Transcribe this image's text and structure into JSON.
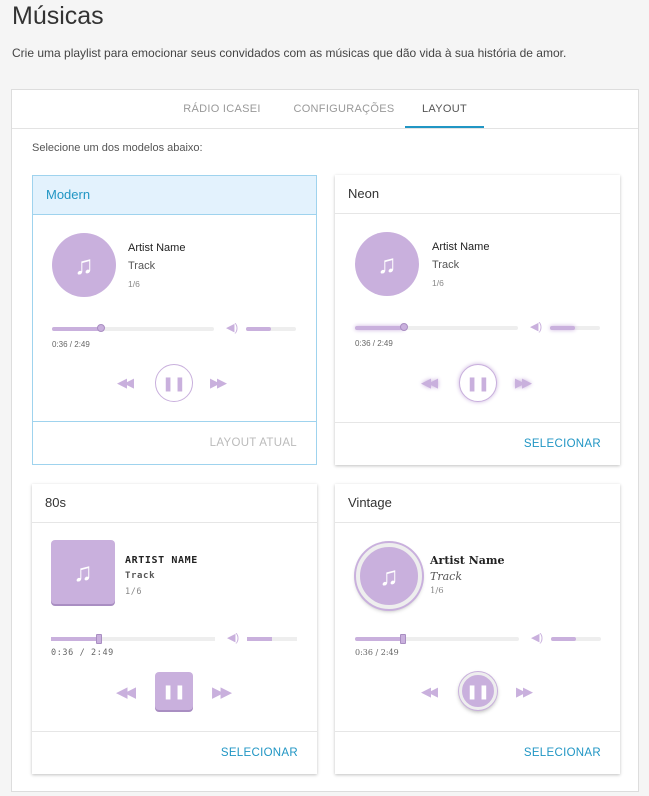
{
  "page": {
    "title": "Músicas",
    "subtitle": "Crie uma playlist para emocionar seus convidados com as músicas que dão vida à sua história de amor."
  },
  "tabs": [
    {
      "label": "RÁDIO ICASEI",
      "active": false
    },
    {
      "label": "CONFIGURAÇÕES",
      "active": false
    },
    {
      "label": "LAYOUT",
      "active": true
    }
  ],
  "instructions": "Selecione um dos modelos abaixo:",
  "accent_color": "#2196c4",
  "player_color": "#c9b0dd",
  "icons": {
    "cover": "music-note-icon",
    "rewind": "rewind-icon",
    "pause": "pause-icon",
    "forward": "fast-forward-icon",
    "volume": "volume-icon"
  },
  "layouts": [
    {
      "name": "Modern",
      "artist": "Artist Name",
      "track": "Track",
      "count": "1/6",
      "time": "0:36 / 2:49",
      "progress": 0.3,
      "volume": 0.5,
      "action": "LAYOUT ATUAL",
      "selected": true
    },
    {
      "name": "Neon",
      "artist": "Artist Name",
      "track": "Track",
      "count": "1/6",
      "time": "0:36 / 2:49",
      "progress": 0.3,
      "volume": 0.5,
      "action": "SELECIONAR",
      "selected": false
    },
    {
      "name": "80s",
      "artist": "ARTIST NAME",
      "track": "Track",
      "count": "1/6",
      "time": "0:36 / 2:49",
      "progress": 0.3,
      "volume": 0.5,
      "action": "SELECIONAR",
      "selected": false
    },
    {
      "name": "Vintage",
      "artist": "Artist Name",
      "track": "Track",
      "count": "1/6",
      "time": "0:36 / 2:49",
      "progress": 0.3,
      "volume": 0.5,
      "action": "SELECIONAR",
      "selected": false
    }
  ]
}
